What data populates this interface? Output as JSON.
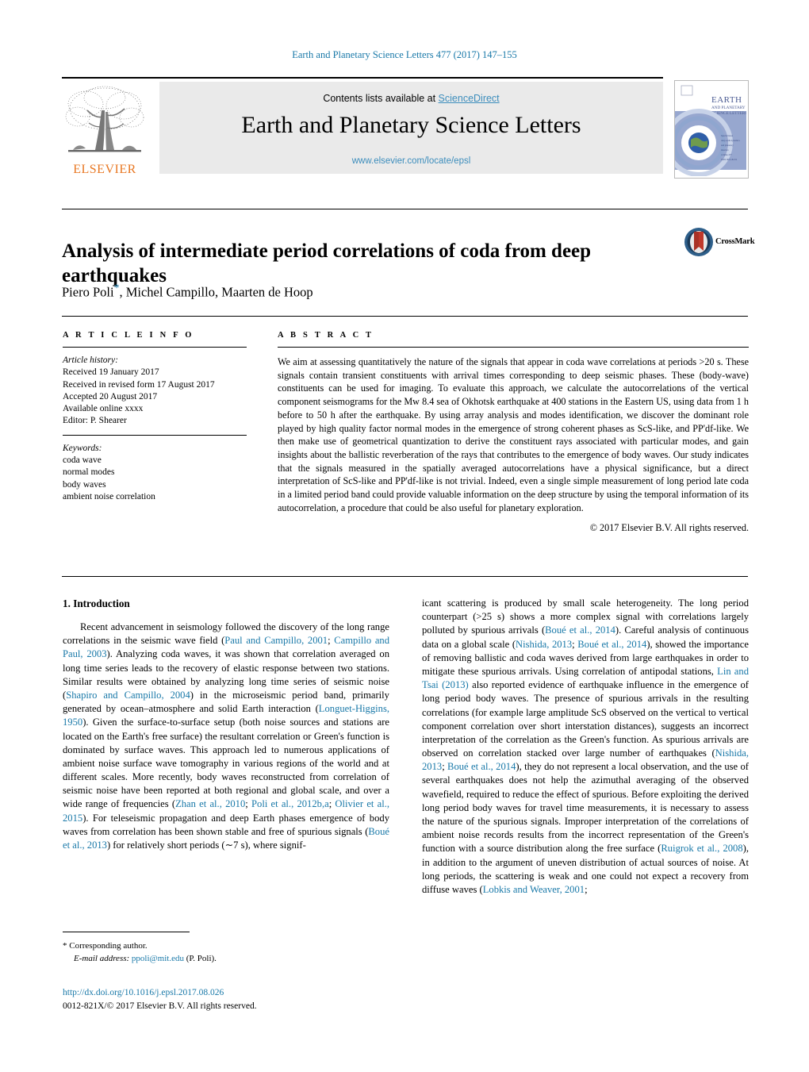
{
  "running_head": "Earth and Planetary Science Letters 477 (2017) 147–155",
  "masthead": {
    "publisher": "ELSEVIER",
    "contents_prefix": "Contents lists available at ",
    "contents_link": "ScienceDirect",
    "journal_title": "Earth and Planetary Science Letters",
    "journal_url": "www.elsevier.com/locate/epsl",
    "cover_title_line1": "EARTH",
    "cover_title_line2": "AND PLANETARY",
    "cover_title_line3": "SCIENCE LETTERS"
  },
  "article": {
    "title": "Analysis of intermediate period correlations of coda from deep earthquakes",
    "authors_pre": "Piero Poli",
    "authors_post": ", Michel Campillo, Maarten de Hoop",
    "corresponding_mark": "*",
    "crossmark_label": "CrossMark"
  },
  "article_info": {
    "heading": "A R T I C L E    I N F O",
    "history_label": "Article history:",
    "history": [
      "Received 19 January 2017",
      "Received in revised form 17 August 2017",
      "Accepted 20 August 2017",
      "Available online xxxx",
      "Editor: P. Shearer"
    ],
    "keywords_label": "Keywords:",
    "keywords": [
      "coda wave",
      "normal modes",
      "body waves",
      "ambient noise correlation"
    ]
  },
  "abstract": {
    "heading": "A B S T R A C T",
    "text": "We aim at assessing quantitatively the nature of the signals that appear in coda wave correlations at periods >20 s. These signals contain transient constituents with arrival times corresponding to deep seismic phases. These (body-wave) constituents can be used for imaging. To evaluate this approach, we calculate the autocorrelations of the vertical component seismograms for the Mw 8.4 sea of Okhotsk earthquake at 400 stations in the Eastern US, using data from 1 h before to 50 h after the earthquake. By using array analysis and modes identification, we discover the dominant role played by high quality factor normal modes in the emergence of strong coherent phases as ScS-like, and PP'df-like. We then make use of geometrical quantization to derive the constituent rays associated with particular modes, and gain insights about the ballistic reverberation of the rays that contributes to the emergence of body waves. Our study indicates that the signals measured in the spatially averaged autocorrelations have a physical significance, but a direct interpretation of ScS-like and PP'df-like is not trivial. Indeed, even a single simple measurement of long period late coda in a limited period band could provide valuable information on the deep structure by using the temporal information of its autocorrelation, a procedure that could be also useful for planetary exploration.",
    "copyright": "© 2017 Elsevier B.V. All rights reserved."
  },
  "body": {
    "section_title": "1. Introduction",
    "left_segments": [
      {
        "t": "Recent advancement in seismology followed the discovery of the long range correlations in the seismic wave field (",
        "ref": false
      },
      {
        "t": "Paul and Campillo, 2001",
        "ref": true
      },
      {
        "t": "; ",
        "ref": false
      },
      {
        "t": "Campillo and Paul, 2003",
        "ref": true
      },
      {
        "t": "). Analyzing coda waves, it was shown that correlation averaged on long time series leads to the recovery of elastic response between two stations. Similar results were obtained by analyzing long time series of seismic noise (",
        "ref": false
      },
      {
        "t": "Shapiro and Campillo, 2004",
        "ref": true
      },
      {
        "t": ") in the microseismic period band, primarily generated by ocean–atmosphere and solid Earth interaction (",
        "ref": false
      },
      {
        "t": "Longuet-Higgins, 1950",
        "ref": true
      },
      {
        "t": "). Given the surface-to-surface setup (both noise sources and stations are located on the Earth's free surface) the resultant correlation or Green's function is dominated by surface waves. This approach led to numerous applications of ambient noise surface wave tomography in various regions of the world and at different scales. More recently, body waves reconstructed from correlation of seismic noise have been reported at both regional and global scale, and over a wide range of frequencies (",
        "ref": false
      },
      {
        "t": "Zhan et al., 2010",
        "ref": true
      },
      {
        "t": "; ",
        "ref": false
      },
      {
        "t": "Poli et al., 2012b,a",
        "ref": true
      },
      {
        "t": "; ",
        "ref": false
      },
      {
        "t": "Olivier et al., 2015",
        "ref": true
      },
      {
        "t": "). For teleseismic propagation and deep Earth phases emergence of body waves from correlation has been shown stable and free of spurious signals (",
        "ref": false
      },
      {
        "t": "Boué et al., 2013",
        "ref": true
      },
      {
        "t": ") for relatively short periods (∼7 s), where signif-",
        "ref": false
      }
    ],
    "right_segments": [
      {
        "t": "icant scattering is produced by small scale heterogeneity. The long period counterpart (>25 s) shows a more complex signal with correlations largely polluted by spurious arrivals (",
        "ref": false
      },
      {
        "t": "Boué et al., 2014",
        "ref": true
      },
      {
        "t": "). Careful analysis of continuous data on a global scale (",
        "ref": false
      },
      {
        "t": "Nishida, 2013",
        "ref": true
      },
      {
        "t": "; ",
        "ref": false
      },
      {
        "t": "Boué et al., 2014",
        "ref": true
      },
      {
        "t": "), showed the importance of removing ballistic and coda waves derived from large earthquakes in order to mitigate these spurious arrivals. Using correlation of antipodal stations, ",
        "ref": false
      },
      {
        "t": "Lin and Tsai (2013)",
        "ref": true
      },
      {
        "t": " also reported evidence of earthquake influence in the emergence of long period body waves. The presence of spurious arrivals in the resulting correlations (for example large amplitude ScS observed on the vertical to vertical component correlation over short interstation distances), suggests an incorrect interpretation of the correlation as the Green's function. As spurious arrivals are observed on correlation stacked over large number of earthquakes (",
        "ref": false
      },
      {
        "t": "Nishida, 2013",
        "ref": true
      },
      {
        "t": "; ",
        "ref": false
      },
      {
        "t": "Boué et al., 2014",
        "ref": true
      },
      {
        "t": "), they do not represent a local observation, and the use of several earthquakes does not help the azimuthal averaging of the observed wavefield, required to reduce the effect of spurious. Before exploiting the derived long period body waves for travel time measurements, it is necessary to assess the nature of the spurious signals. Improper interpretation of the correlations of ambient noise records results from the incorrect representation of the Green's function with a source distribution along the free surface (",
        "ref": false
      },
      {
        "t": "Ruigrok et al., 2008",
        "ref": true
      },
      {
        "t": "), in addition to the argument of uneven distribution of actual sources of noise. At long periods, the scattering is weak and one could not expect a recovery from diffuse waves (",
        "ref": false
      },
      {
        "t": "Lobkis and Weaver, 2001",
        "ref": true
      },
      {
        "t": ";",
        "ref": false
      }
    ]
  },
  "footer": {
    "corresponding_mark": "*",
    "corresponding_text": "Corresponding author.",
    "email_label": "E-mail address:",
    "email": "ppoli@mit.edu",
    "email_suffix": "(P. Poli).",
    "doi": "http://dx.doi.org/10.1016/j.epsl.2017.08.026",
    "issn_line": "0012-821X/© 2017 Elsevier B.V. All rights reserved."
  },
  "colors": {
    "link": "#1878a8",
    "sciencedirect": "#3c8dbc",
    "elsevier_orange": "#e87722",
    "band_gray": "#eaeaea"
  }
}
